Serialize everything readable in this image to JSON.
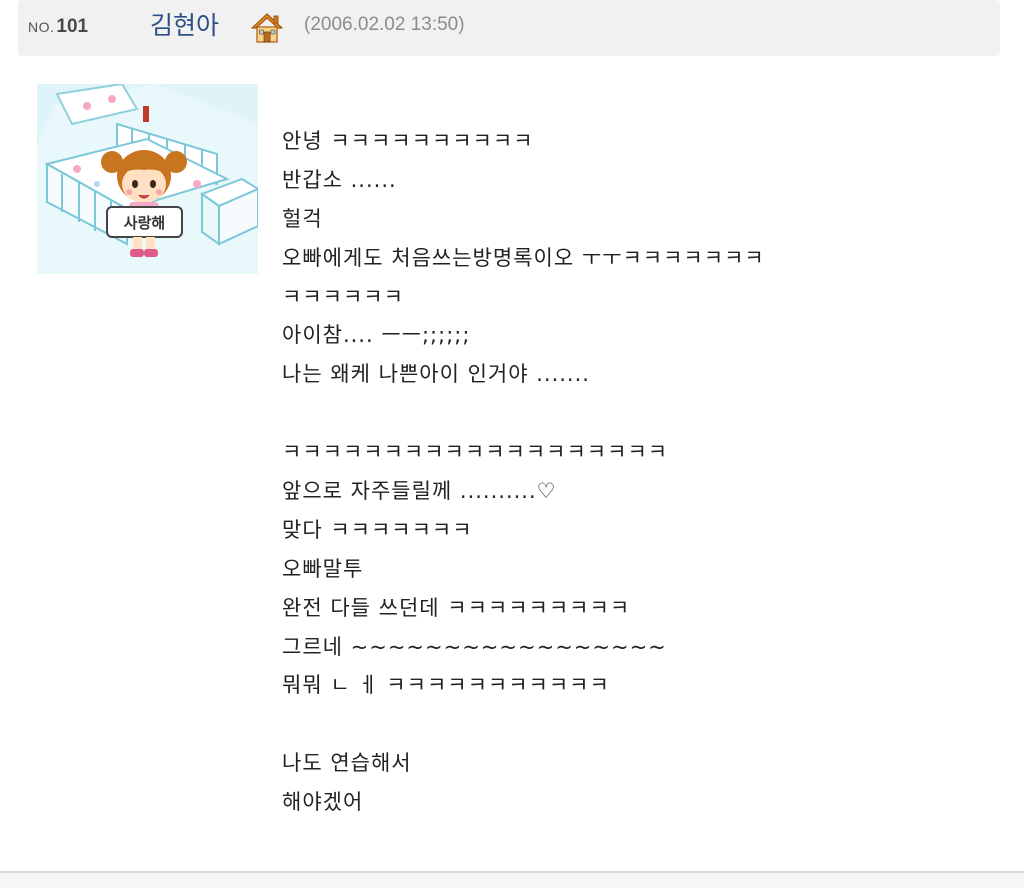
{
  "post": {
    "number_prefix": "NO.",
    "number": "101",
    "author": "김현아",
    "date": "(2006.02.02 13:50)"
  },
  "avatar": {
    "sign_text": "사랑해"
  },
  "message_lines": [
    "안녕 ㅋㅋㅋㅋㅋㅋㅋㅋㅋㅋ",
    "반갑소 ......",
    "헐걱",
    "오빠에게도 처음쓰는방명록이오 ㅜㅜㅋㅋㅋㅋㅋㅋㅋ",
    "ㅋㅋㅋㅋㅋㅋ",
    "아이참.... ㅡㅡ;;;;;;",
    "나는 왜케 나쁜아이 인거야 .......",
    "",
    "ㅋㅋㅋㅋㅋㅋㅋㅋㅋㅋㅋㅋㅋㅋㅋㅋㅋㅋㅋ",
    "앞으로 자주들릴께 ..........♡",
    "맞다 ㅋㅋㅋㅋㅋㅋㅋ",
    "오빠말투",
    "완전 다들 쓰던데 ㅋㅋㅋㅋㅋㅋㅋㅋㅋ",
    "그르네 ~~~~~~~~~~~~~~~~~",
    "뭐뭐 ㄴ ㅔ ㅋㅋㅋㅋㅋㅋㅋㅋㅋㅋㅋ",
    "",
    "나도 연습해서",
    "해야겠어"
  ]
}
